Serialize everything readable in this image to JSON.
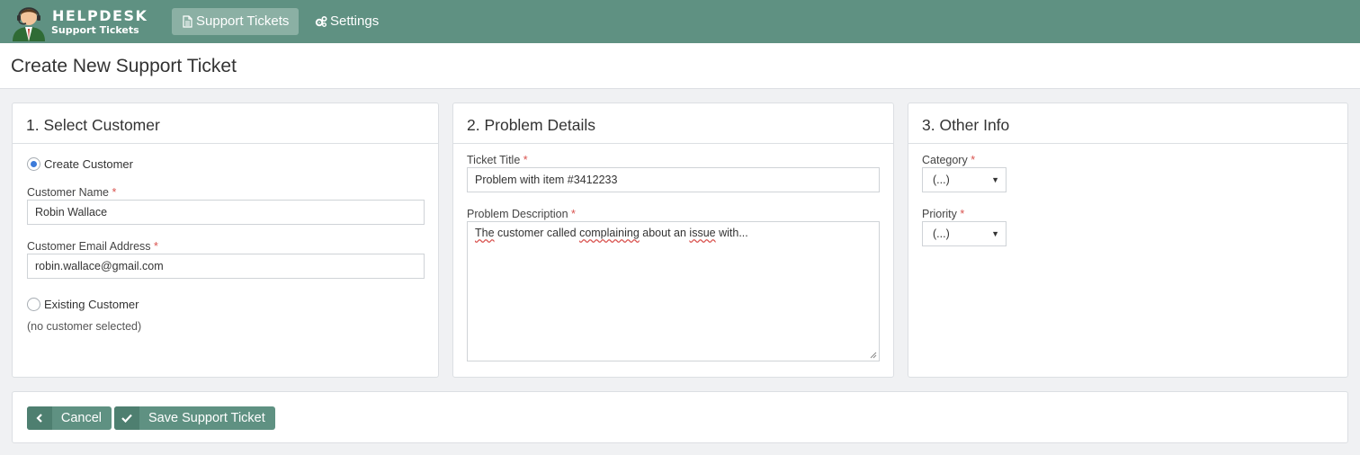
{
  "brand": {
    "name": "HELPDESK",
    "tagline": "Support Tickets"
  },
  "nav": {
    "tickets_label": "Support Tickets",
    "settings_label": "Settings"
  },
  "page": {
    "title": "Create New Support Ticket"
  },
  "customer_panel": {
    "heading": "1. Select Customer",
    "create_option": "Create Customer",
    "create_selected": true,
    "name_label": "Customer Name",
    "name_value": "Robin Wallace",
    "email_label": "Customer Email Address",
    "email_value": "robin.wallace@gmail.com",
    "existing_option": "Existing Customer",
    "existing_status": "(no customer selected)"
  },
  "problem_panel": {
    "heading": "2. Problem Details",
    "title_label": "Ticket Title",
    "title_value": "Problem with item #3412233",
    "description_label": "Problem Description",
    "description_words": [
      "The",
      "customer called",
      "complaining",
      "about an",
      "issue",
      "with..."
    ]
  },
  "other_panel": {
    "heading": "3. Other Info",
    "category_label": "Category",
    "category_value": "(...)",
    "priority_label": "Priority",
    "priority_value": "(...)"
  },
  "required_marker": "*",
  "actions": {
    "cancel_label": "Cancel",
    "save_label": "Save Support Ticket"
  },
  "colors": {
    "navbar": "#5f9182",
    "active_nav": "#8bb0a4",
    "button": "#5f9182",
    "required": "#d9534f",
    "radio_checked": "#3b7ad9"
  },
  "icons": {
    "tickets": "document-icon",
    "settings": "gears-icon",
    "cancel": "chevron-left-icon",
    "save": "checkmark-icon",
    "select_caret": "caret-down-icon"
  }
}
